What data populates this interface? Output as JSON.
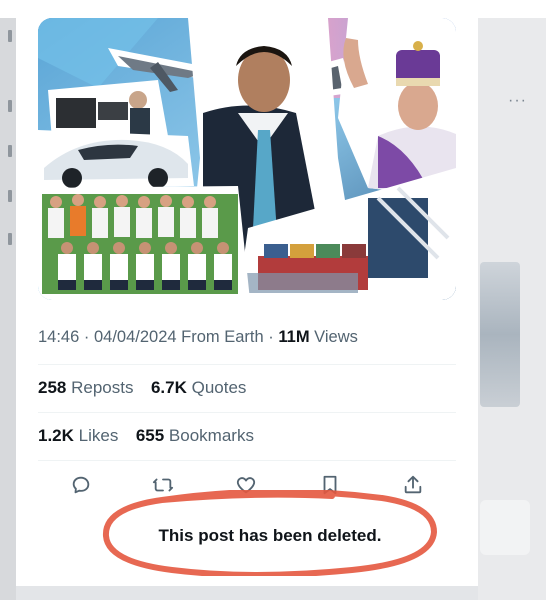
{
  "post": {
    "meta": {
      "time": "14:46",
      "date": "04/04/2024",
      "source": "From Earth",
      "views_count": "11M",
      "views_label": "Views"
    },
    "stats": {
      "reposts_count": "258",
      "reposts_label": "Reposts",
      "quotes_count": "6.7K",
      "quotes_label": "Quotes",
      "likes_count": "1.2K",
      "likes_label": "Likes",
      "bookmarks_count": "655",
      "bookmarks_label": "Bookmarks"
    },
    "actions": [
      "reply-icon",
      "repost-icon",
      "like-icon",
      "bookmark-icon",
      "share-icon"
    ],
    "deleted_notice": "This post has been deleted."
  },
  "background": {
    "more_dots": "···"
  },
  "colors": {
    "primary_text": "#0f1419",
    "secondary_text": "#536471",
    "annotation_ring": "#e4583f",
    "divider": "#eff3f4"
  }
}
